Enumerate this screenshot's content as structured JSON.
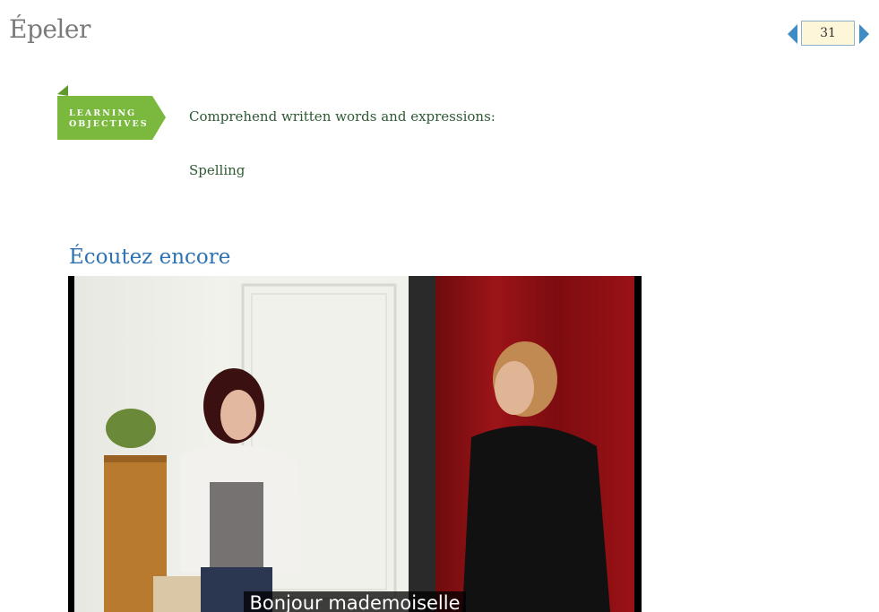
{
  "page": {
    "title": "Épeler"
  },
  "pager": {
    "page_number": "31",
    "prev_icon": "triangle-left-icon",
    "next_icon": "triangle-right-icon",
    "accent_color": "#3d8cc6"
  },
  "learning_objectives": {
    "banner_label_line1": "LEARNING",
    "banner_label_line2": "OBJECTIVES",
    "banner_color": "#7ab83e",
    "heading": "Comprehend written words and expressions:",
    "items": [
      "Spelling"
    ]
  },
  "section": {
    "heading": "Écoutez encore"
  },
  "video": {
    "subtitle": "Bonjour mademoiselle"
  }
}
